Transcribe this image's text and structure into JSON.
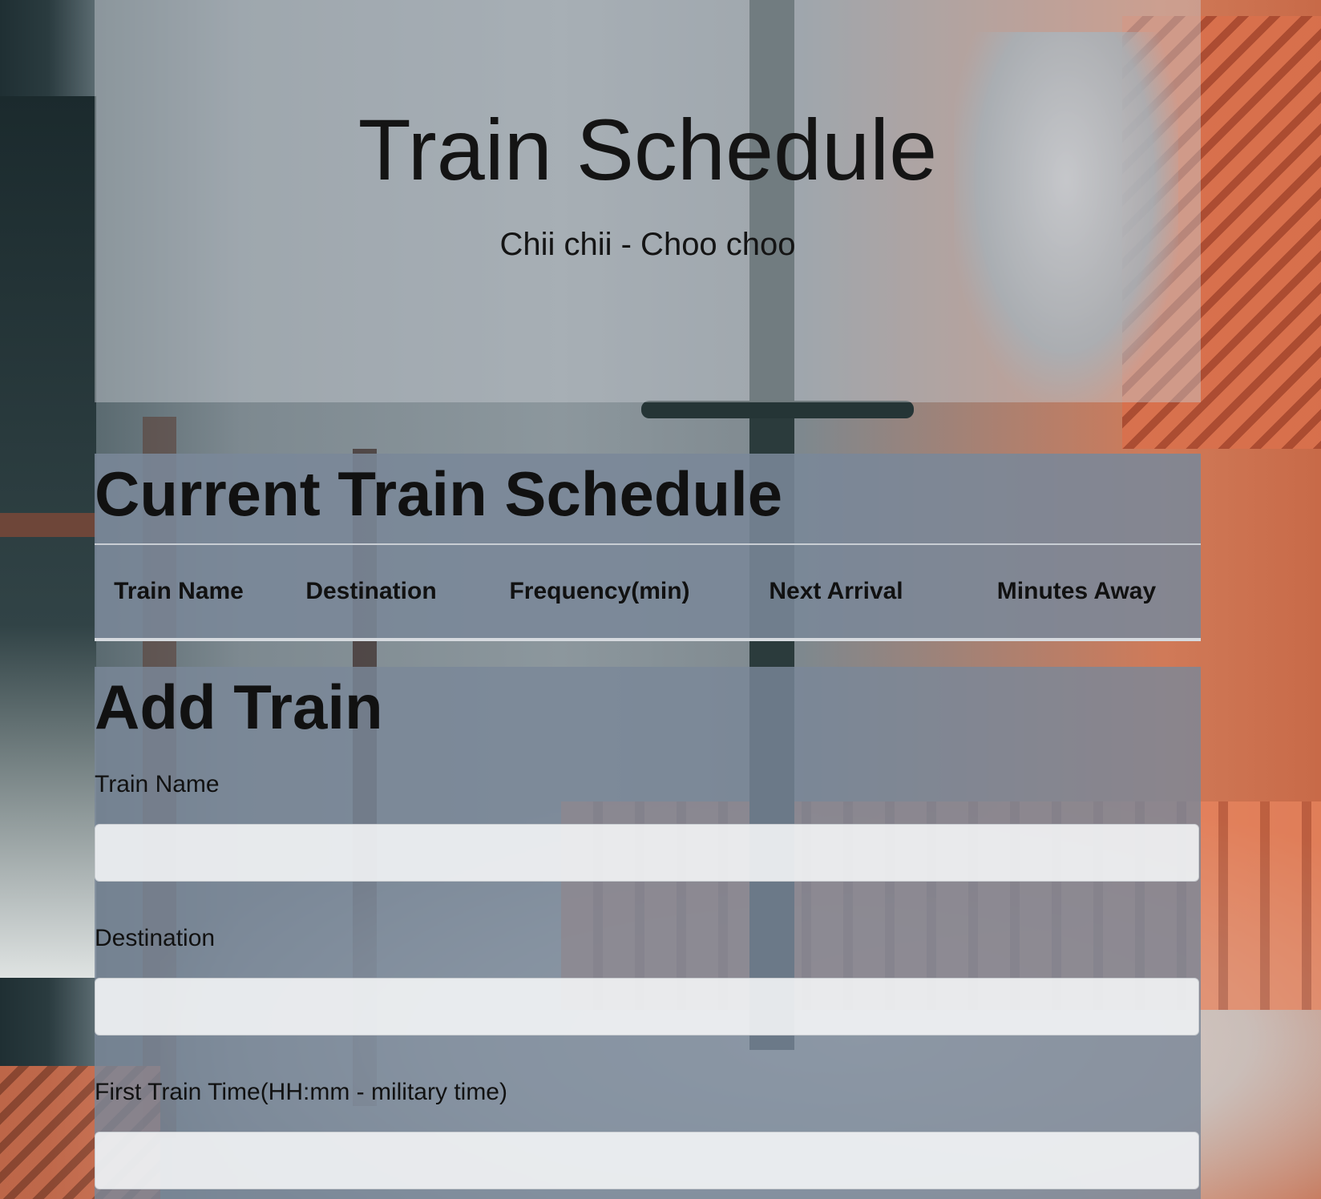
{
  "header": {
    "title": "Train Schedule",
    "subtitle": "Chii chii - Choo choo"
  },
  "schedule": {
    "heading": "Current Train Schedule",
    "columns": [
      "Train Name",
      "Destination",
      "Frequency(min)",
      "Next Arrival",
      "Minutes Away"
    ],
    "rows": []
  },
  "add_train": {
    "heading": "Add Train",
    "fields": [
      {
        "label": "Train Name",
        "value": "",
        "placeholder": ""
      },
      {
        "label": "Destination",
        "value": "",
        "placeholder": ""
      },
      {
        "label": "First Train Time(HH:mm - military time)",
        "value": "",
        "placeholder": ""
      }
    ]
  }
}
